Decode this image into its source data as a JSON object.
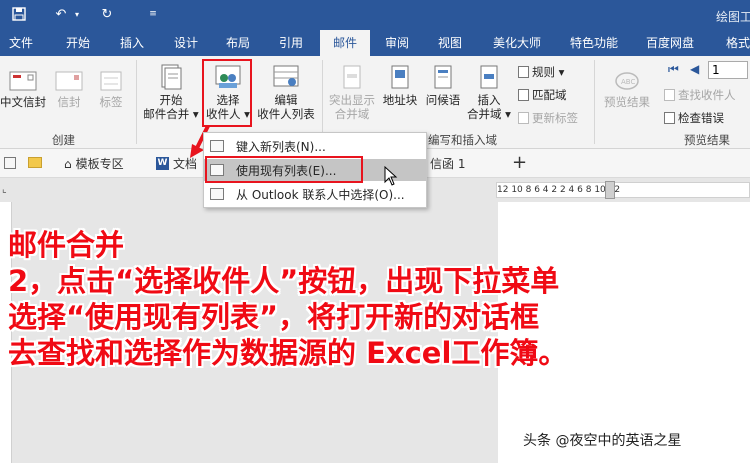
{
  "titlebar": {
    "window_title": "绘图工",
    "save_icon": "save-icon",
    "undo_icon": "undo-icon",
    "redo_icon": "redo-icon"
  },
  "tabs": [
    "文件",
    "开始",
    "插入",
    "设计",
    "布局",
    "引用",
    "邮件",
    "审阅",
    "视图",
    "美化大师",
    "特色功能",
    "百度网盘",
    "格式"
  ],
  "active_tab": "邮件",
  "ribbon": {
    "create_group": {
      "label": "创建",
      "buttons": [
        "中文信封",
        "信封",
        "标签"
      ]
    },
    "start_group": {
      "start_merge": [
        "开始",
        "邮件合并 ▾"
      ],
      "select_recipients": [
        "选择",
        "收件人 ▾"
      ],
      "edit_recipients": [
        "编辑",
        "收件人列表"
      ]
    },
    "write_group": {
      "label": "编写和插入域",
      "highlight": [
        "突出显示",
        "合并域"
      ],
      "address_block": "地址块",
      "greeting": "问候语",
      "insert_field": [
        "插入",
        "合并域 ▾"
      ],
      "rules": "规则 ▾",
      "match_fields": "匹配域",
      "update_labels": "更新标签"
    },
    "preview_group": {
      "label": "预览结果",
      "preview_results": "预览结果",
      "record_number": "1",
      "find_recipient": "查找收件人",
      "check_errors": "检查错误"
    }
  },
  "menu": {
    "items": [
      "键入新列表(N)...",
      "使用现有列表(E)...",
      "从 Outlook 联系人中选择(O)..."
    ],
    "highlighted_index": 1
  },
  "doctabs": {
    "template_zone": "模板专区",
    "doc_prefix": "文档",
    "doc_suffix": "信函 1",
    "add": "+"
  },
  "ruler": {
    "ticks": "12 10 8 6 4 2 2 4 6 8 10 12"
  },
  "caption": {
    "line1": "邮件合并",
    "line2": "2，点击“选择收件人”按钮，出现下拉菜单",
    "line3": "选择“使用现有列表”，将打开新的对话框",
    "line4": "去查找和选择作为数据源的 Excel工作簿。"
  },
  "watermark": "头条 @夜空中的英语之星",
  "colors": {
    "brand": "#2b579a",
    "annotation_red": "#e8141e",
    "caption_red": "#f00a14"
  }
}
